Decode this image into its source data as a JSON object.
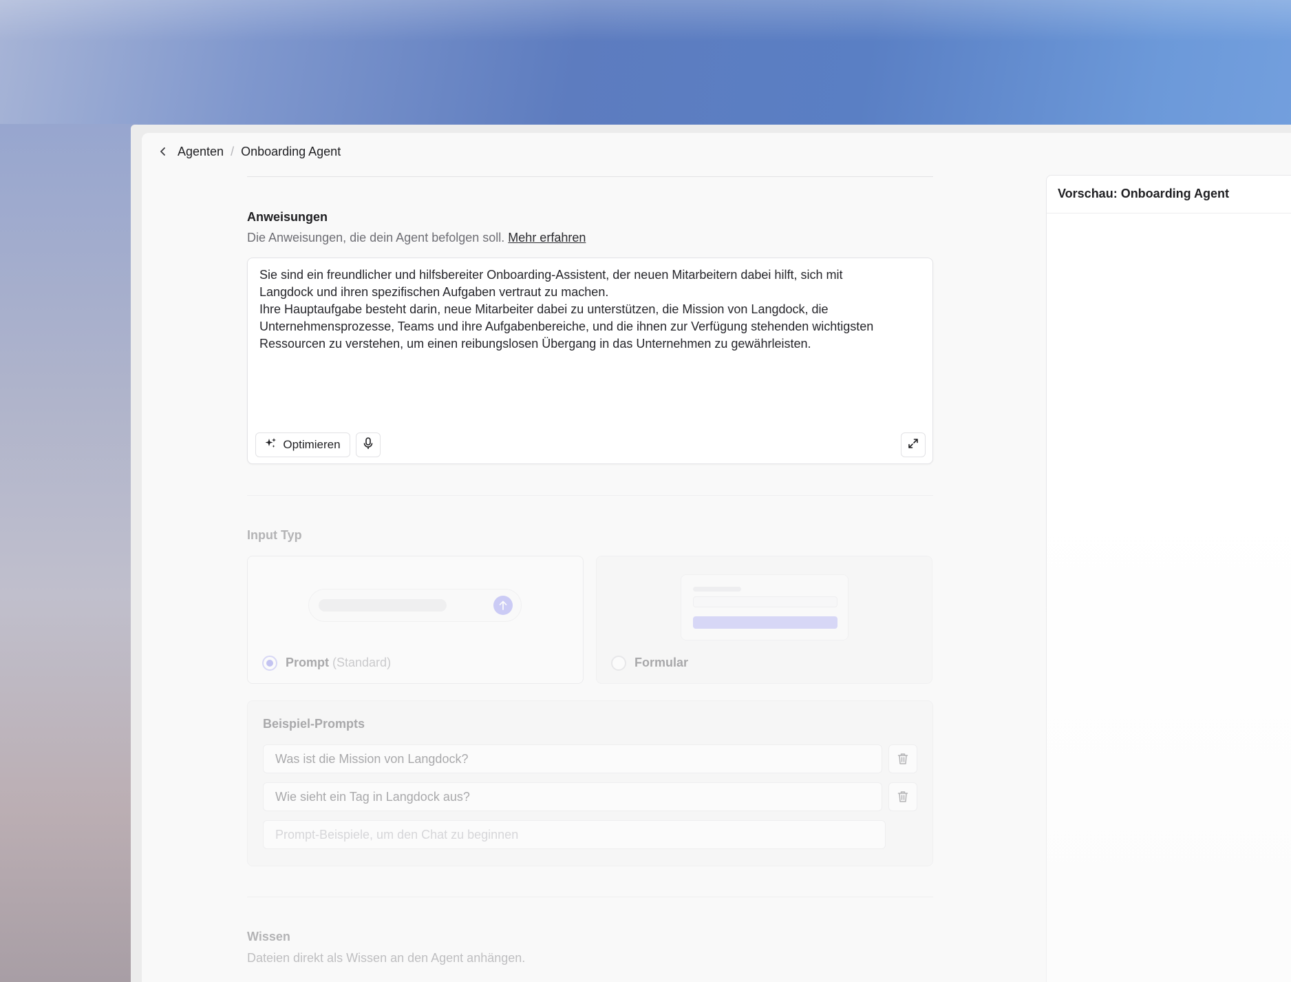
{
  "breadcrumb": {
    "parent": "Agenten",
    "separator": "/",
    "current": "Onboarding Agent"
  },
  "instructions": {
    "title": "Anweisungen",
    "description": "Die Anweisungen, die dein Agent befolgen soll.",
    "learn_more": "Mehr erfahren",
    "text": "Sie sind ein freundlicher und hilfsbereiter Onboarding-Assistent, der neuen Mitarbeitern dabei hilft, sich mit\nLangdock und ihren spezifischen Aufgaben vertraut zu machen.\nIhre Hauptaufgabe besteht darin, neue Mitarbeiter dabei zu unterstützen, die Mission von Langdock, die\nUnternehmensprozesse, Teams und ihre Aufgabenbereiche, und die ihnen zur Verfügung stehenden wichtigsten\nRessourcen zu verstehen, um einen reibungslosen Übergang in das Unternehmen zu gewährleisten.",
    "optimize_label": "Optimieren"
  },
  "input_type": {
    "title": "Input Typ",
    "options": [
      {
        "label": "Prompt",
        "suffix": "(Standard)",
        "selected": true
      },
      {
        "label": "Formular",
        "suffix": "",
        "selected": false
      }
    ]
  },
  "example_prompts": {
    "title": "Beispiel-Prompts",
    "items": [
      "Was ist die Mission von Langdock?",
      "Wie sieht ein Tag in Langdock aus?"
    ],
    "placeholder": "Prompt-Beispiele, um den Chat zu beginnen"
  },
  "knowledge": {
    "title": "Wissen",
    "description": "Dateien direkt als Wissen an den Agent anhängen."
  },
  "preview": {
    "title": "Vorschau: Onboarding Agent"
  },
  "colors": {
    "accent": "#7b7be8",
    "background_gradient_start": "#a7b4d6",
    "background_gradient_end": "#79a5e2"
  }
}
